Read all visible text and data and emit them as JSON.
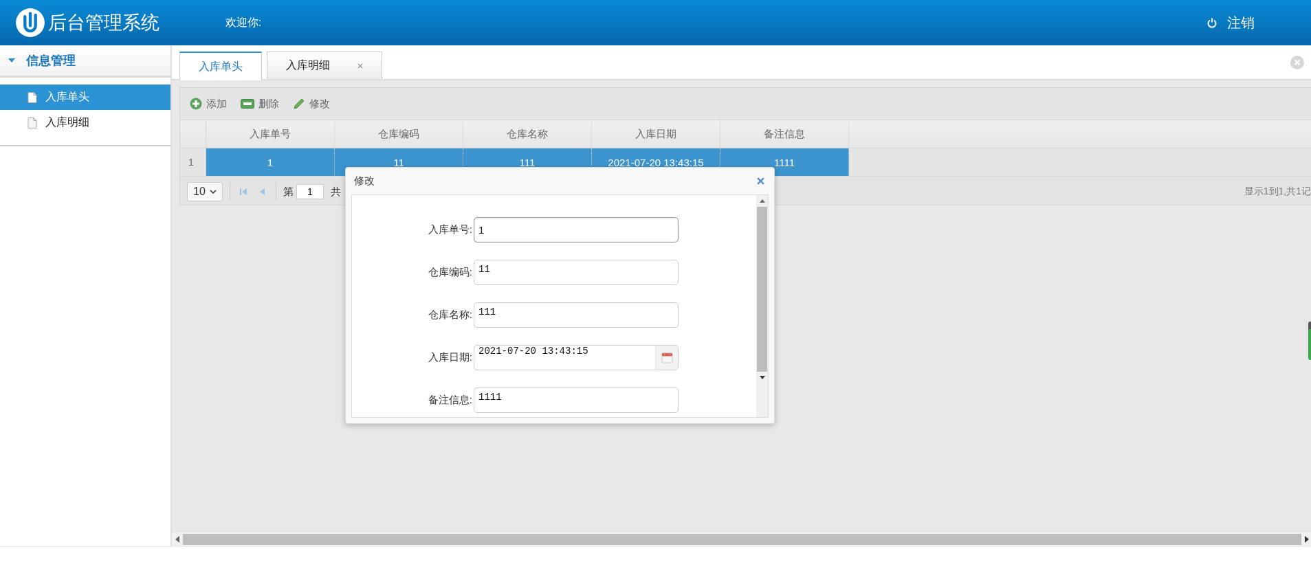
{
  "header": {
    "title": "后台管理系统",
    "welcome": "欢迎你:",
    "logout": "注销"
  },
  "sidebar": {
    "section": {
      "title": "信息管理",
      "expanded": true
    },
    "items": [
      {
        "label": "入库单头",
        "selected": true
      },
      {
        "label": "入库明细",
        "selected": false
      }
    ]
  },
  "tabs": [
    {
      "label": "入库单头",
      "selected": true,
      "closable": false
    },
    {
      "label": "入库明细",
      "selected": false,
      "closable": true
    }
  ],
  "toolbar": [
    {
      "kind": "add",
      "label": "添加"
    },
    {
      "kind": "delete",
      "label": "删除"
    },
    {
      "kind": "edit",
      "label": "修改"
    }
  ],
  "table": {
    "columns": [
      "入库单号",
      "仓库编码",
      "仓库名称",
      "入库日期",
      "备注信息"
    ],
    "rows": [
      {
        "number": "1",
        "cells": [
          "1",
          "11",
          "111",
          "2021-07-20 13:43:15",
          "1111"
        ],
        "selected": true
      }
    ]
  },
  "pager": {
    "page_size": "10",
    "page_prefix": "第",
    "page": "1",
    "page_suffix": "共",
    "summary": "显示1到1,共1记"
  },
  "dialog": {
    "title": "修改",
    "fields": [
      {
        "label": "入库单号:",
        "value": "1",
        "kind": "text",
        "focused": true
      },
      {
        "label": "仓库编码:",
        "value": "11",
        "kind": "text",
        "focused": false
      },
      {
        "label": "仓库名称:",
        "value": "111",
        "kind": "text",
        "focused": false
      },
      {
        "label": "入库日期:",
        "value": "2021-07-20 13:43:15",
        "kind": "date",
        "focused": false
      },
      {
        "label": "备注信息:",
        "value": "1111",
        "kind": "text",
        "focused": false
      }
    ]
  }
}
